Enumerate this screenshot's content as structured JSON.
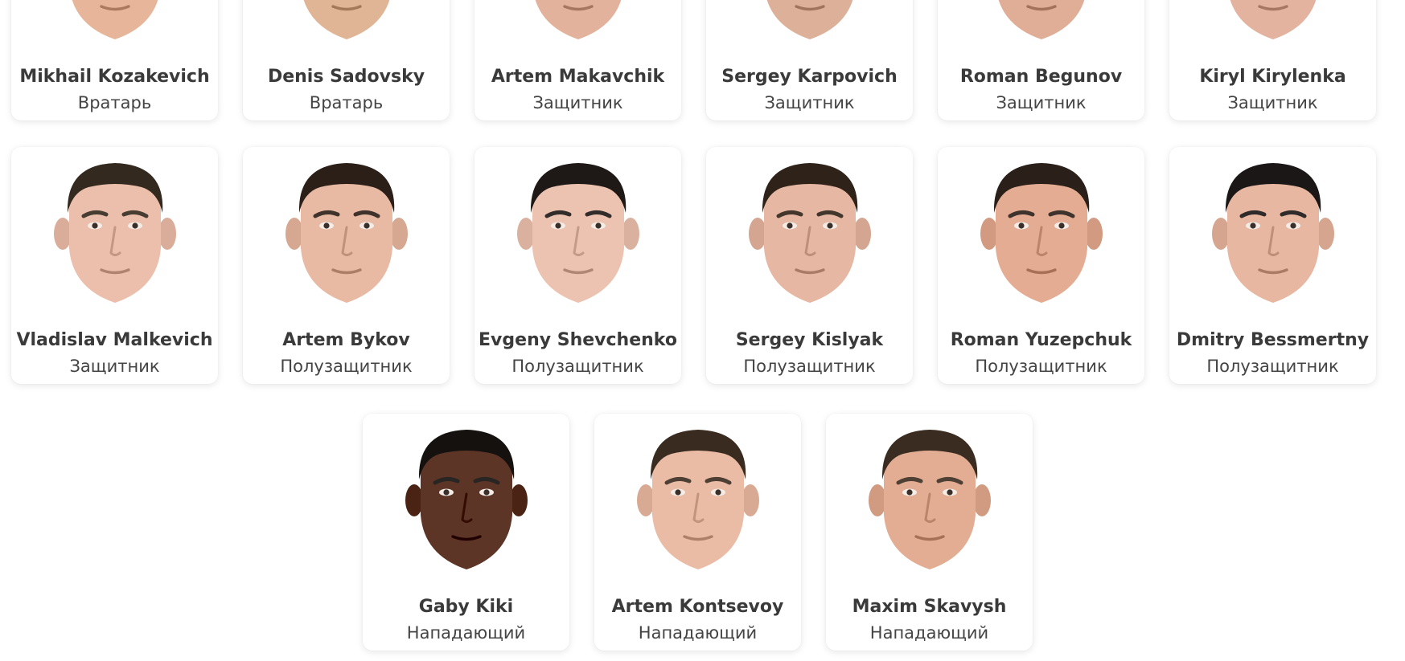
{
  "colors": {
    "card_bg": "#ffffff",
    "name_text": "#3a3a3a",
    "position_text": "#444444",
    "skin_light": "#e8b9a0",
    "skin_dark": "#5a3426",
    "hair": "#2a2420"
  },
  "players": [
    {
      "name": "Mikhail Kozakevich",
      "position": "Вратарь",
      "skin": "#e6b59a",
      "hair": "#2a2420"
    },
    {
      "name": "Denis Sadovsky",
      "position": "Вратарь",
      "skin": "#e0b596",
      "hair": "#2a2420"
    },
    {
      "name": "Artem Makavchik",
      "position": "Защитник",
      "skin": "#e3b29c",
      "hair": "#2a2420"
    },
    {
      "name": "Sergey Karpovich",
      "position": "Защитник",
      "skin": "#ddb09a",
      "hair": "#2a2420"
    },
    {
      "name": "Roman Begunov",
      "position": "Защитник",
      "skin": "#e0ad96",
      "hair": "#2a2420"
    },
    {
      "name": "Kiryl Kirylenka",
      "position": "Защитник",
      "skin": "#e3b3a0",
      "hair": "#2a2420"
    },
    {
      "name": "Vladislav Malkevich",
      "position": "Защитник",
      "skin": "#ebbfab",
      "hair": "#33291f"
    },
    {
      "name": "Artem Bykov",
      "position": "Полузащитник",
      "skin": "#e8b9a3",
      "hair": "#2b1f18"
    },
    {
      "name": "Evgeny Shevchenko",
      "position": "Полузащитник",
      "skin": "#ecc2b1",
      "hair": "#1e1916"
    },
    {
      "name": "Sergey Kislyak",
      "position": "Полузащитник",
      "skin": "#e6b7a2",
      "hair": "#2e2219"
    },
    {
      "name": "Roman Yuzepchuk",
      "position": "Полузащитник",
      "skin": "#e3ac93",
      "hair": "#2a1f19"
    },
    {
      "name": "Dmitry Bessmertny",
      "position": "Полузащитник",
      "skin": "#e8b7a1",
      "hair": "#1a1716"
    },
    {
      "name": "Gaby Kiki",
      "position": "Нападающий",
      "skin": "#5c3527",
      "hair": "#15110f"
    },
    {
      "name": "Artem Kontsevoy",
      "position": "Нападающий",
      "skin": "#ebbca5",
      "hair": "#3a2b20"
    },
    {
      "name": "Maxim Skavysh",
      "position": "Нападающий",
      "skin": "#e2ad93",
      "hair": "#3b2c21"
    }
  ]
}
